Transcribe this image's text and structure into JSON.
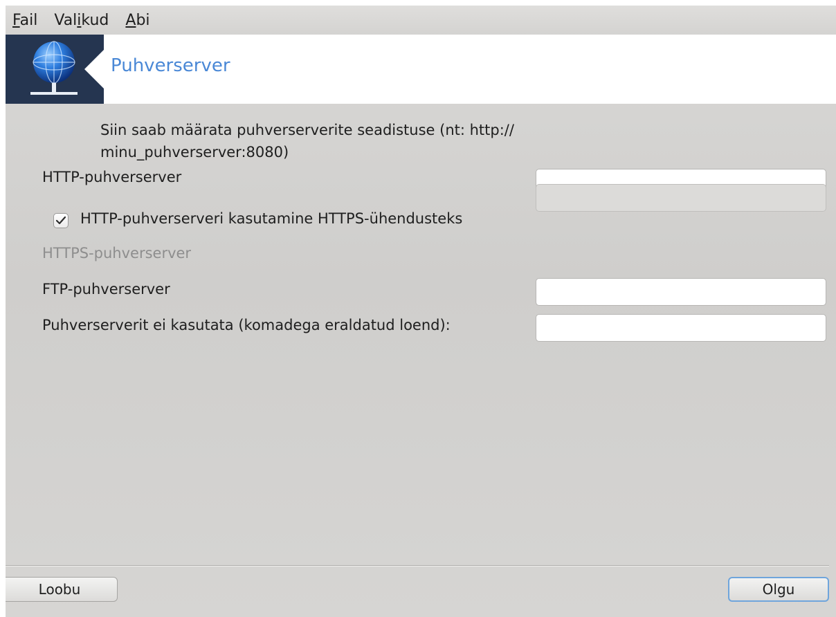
{
  "menubar": {
    "items": [
      {
        "mnemonic": "F",
        "rest": "ail",
        "prefix": ""
      },
      {
        "prefix": "Val",
        "mnemonic": "i",
        "rest": "kud"
      },
      {
        "prefix": "",
        "mnemonic": "A",
        "rest": "bi"
      }
    ]
  },
  "banner": {
    "title": "Puhverserver",
    "icon": "network-globe-icon",
    "background_color": "#253550",
    "title_color": "#4a88d6"
  },
  "form": {
    "description": "Siin saab määrata puhverserverite seadistuse (nt: http:// minu_puhverserver:8080)",
    "http_label": "HTTP-puhverserver",
    "http_value": "",
    "use_http_for_https_label": "HTTP-puhverserveri kasutamine HTTPS-ühendusteks",
    "use_http_for_https_checked": true,
    "https_label": "HTTPS-puhverserver",
    "https_value": "",
    "ftp_label": "FTP-puhverserver",
    "ftp_value": "",
    "no_proxy_label": "Puhverserverit ei kasutata (komadega eraldatud loend):",
    "no_proxy_value": ""
  },
  "buttons": {
    "cancel_label": "Loobu",
    "ok_label": "Olgu"
  }
}
